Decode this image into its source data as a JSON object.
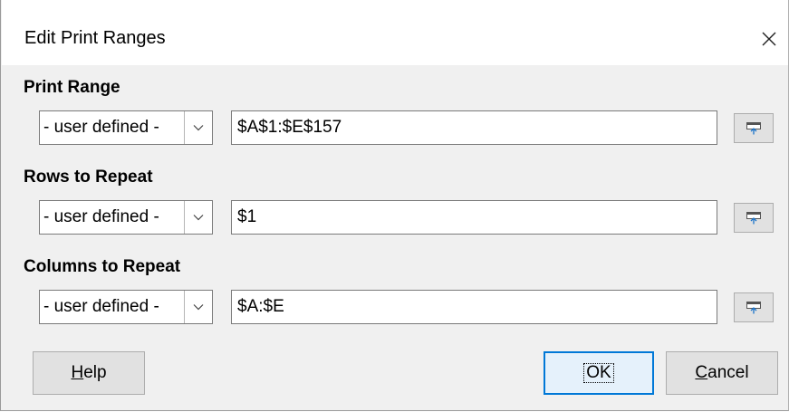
{
  "dialog": {
    "title": "Edit Print Ranges"
  },
  "sections": [
    {
      "label": "Print Range",
      "combo_value": "- user defined -",
      "field_value": "$A$1:$E$157"
    },
    {
      "label": "Rows to Repeat",
      "combo_value": "- user defined -",
      "field_value": "$1"
    },
    {
      "label": "Columns to Repeat",
      "combo_value": "- user defined -",
      "field_value": "$A:$E"
    }
  ],
  "buttons": {
    "help_mnemonic": "H",
    "help_rest": "elp",
    "ok_label": "OK",
    "cancel_mnemonic": "C",
    "cancel_rest": "ancel"
  },
  "icons": {
    "close": "close-icon",
    "dropdown": "chevron-down-icon",
    "shrink": "shrink-dialog-icon"
  },
  "colors": {
    "focus_accent": "#0078d7",
    "dialog_bg": "#f0f0f0"
  }
}
